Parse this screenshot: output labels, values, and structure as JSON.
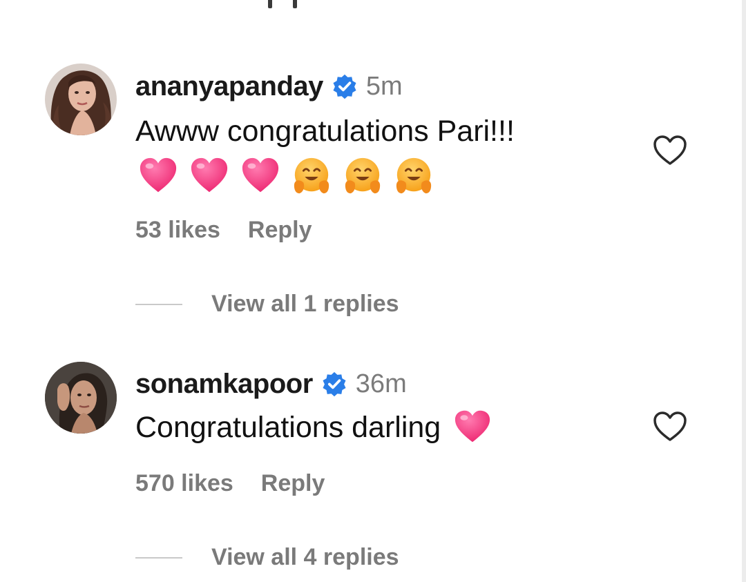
{
  "comments": [
    {
      "username": "ananyapanday",
      "verified": true,
      "time": "5m",
      "text": "Awww congratulations Pari!!!",
      "emojis": [
        "pink-heart",
        "pink-heart",
        "pink-heart",
        "hugging-face",
        "hugging-face",
        "hugging-face"
      ],
      "likes": "53 likes",
      "reply_label": "Reply",
      "view_replies": "View all 1 replies",
      "liked": false
    },
    {
      "username": "sonamkapoor",
      "verified": true,
      "time": "36m",
      "text": "Congratulations darling",
      "emojis": [
        "pink-heart"
      ],
      "likes": "570 likes",
      "reply_label": "Reply",
      "view_replies": "View all 4 replies",
      "liked": false
    }
  ],
  "colors": {
    "verified_blue": "#2a7ee8",
    "heart_pink": "#f2367a",
    "muted_text": "#7a7a7a",
    "primary_text": "#1a1a1a"
  }
}
